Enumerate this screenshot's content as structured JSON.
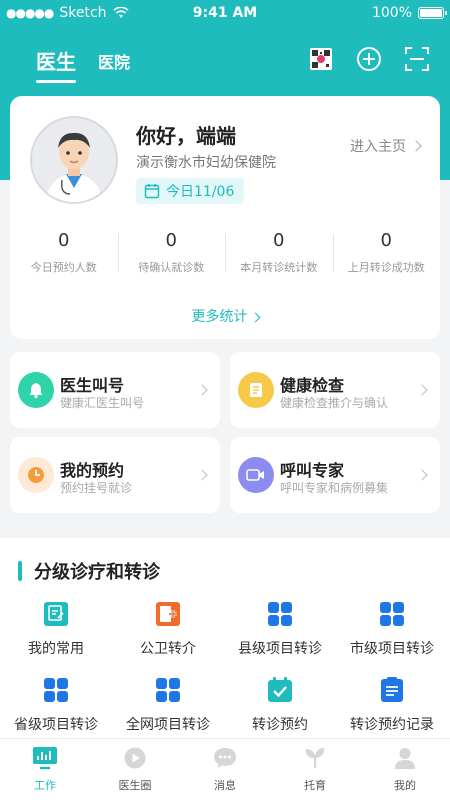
{
  "status_bar": {
    "carrier": "Sketch",
    "time": "9:41 AM",
    "battery": "100%"
  },
  "header": {
    "tabs": [
      {
        "label": "医生",
        "active": true
      },
      {
        "label": "医院",
        "active": false
      }
    ],
    "icons": [
      "qr-code-icon",
      "add-icon",
      "scan-icon"
    ]
  },
  "profile": {
    "greeting": "你好，端端",
    "hospital": "演示衡水市妇幼保健院",
    "date_label": "今日11/06",
    "home_link": "进入主页",
    "stats": [
      {
        "value": "0",
        "label": "今日预约人数"
      },
      {
        "value": "0",
        "label": "待确认就诊数"
      },
      {
        "value": "0",
        "label": "本月转诊统计数"
      },
      {
        "value": "0",
        "label": "上月转诊成功数"
      }
    ],
    "more_stats": "更多统计"
  },
  "tiles": [
    {
      "title": "医生叫号",
      "subtitle": "健康汇医生叫号",
      "icon": "bell-icon",
      "color": "#2fd3a9"
    },
    {
      "title": "健康检查",
      "subtitle": "健康检查推介与确认",
      "icon": "checklist-icon",
      "color": "#f7c948"
    },
    {
      "title": "我的预约",
      "subtitle": "预约挂号就诊",
      "icon": "clock-icon",
      "color": "#f59c3b"
    },
    {
      "title": "呼叫专家",
      "subtitle": "呼叫专家和病例募集",
      "icon": "video-icon",
      "color": "#8c8cf0"
    }
  ],
  "section": {
    "title": "分级诊疗和转诊",
    "items": [
      {
        "label": "我的常用",
        "icon": "frequent-icon"
      },
      {
        "label": "公卫转介",
        "icon": "medical-cross-icon"
      },
      {
        "label": "县级项目转诊",
        "icon": "grid-icon"
      },
      {
        "label": "市级项目转诊",
        "icon": "grid-icon"
      },
      {
        "label": "省级项目转诊",
        "icon": "grid-icon"
      },
      {
        "label": "全网项目转诊",
        "icon": "grid-icon"
      },
      {
        "label": "转诊预约",
        "icon": "calendar-check-icon"
      },
      {
        "label": "转诊预约记录",
        "icon": "record-list-icon"
      }
    ]
  },
  "tabbar": [
    {
      "label": "工作",
      "active": true
    },
    {
      "label": "医生圈",
      "active": false
    },
    {
      "label": "消息",
      "active": false
    },
    {
      "label": "托育",
      "active": false
    },
    {
      "label": "我的",
      "active": false
    }
  ],
  "colors": {
    "accent": "#1fbcbd",
    "page_bg": "#f2f4f6",
    "grid_blue": "#1f76e6",
    "orange": "#f26b2c"
  }
}
